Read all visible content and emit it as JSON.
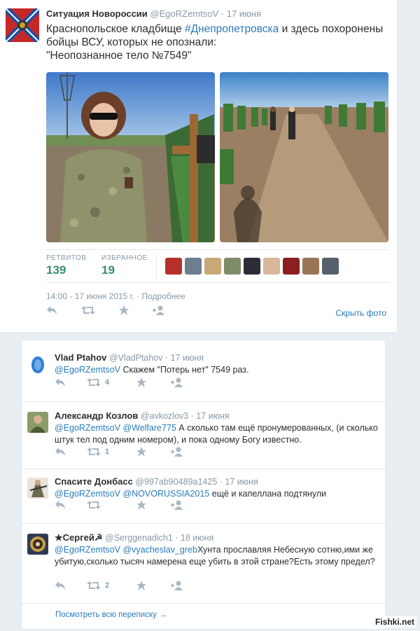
{
  "main_tweet": {
    "fullname": "Ситуация Новороссии",
    "username": "@EgoRZemtsoV",
    "date": "· 17 июня",
    "text_part1": "Краснопольское кладбище ",
    "hashtag": "#Днепропетровска",
    "text_part2": " и здесь похоронены бойцы ВСУ, которых не опознали:",
    "text_part3": "\"Неопознанное тело №7549\"",
    "retweets_label": "РЕТВИТОВ",
    "retweets": "139",
    "favorites_label": "ИЗБРАННОЕ",
    "favorites": "19",
    "timestamp": "14:00 - 17 июня 2015 г. · Подробнее",
    "hide_photo": "Скрыть фото"
  },
  "replies": [
    {
      "fullname": "Vlad Ptahov",
      "username": "@VladPtahov",
      "date": "· 17 июня",
      "mention": "@EgoRZemtsoV",
      "text": " Скажем \"Потерь нет\" 7549 раз.",
      "retweet_count": "4"
    },
    {
      "fullname": "Александр Козлов",
      "username": "@avkozlov3",
      "date": "· 17 июня",
      "mention": "@EgoRZemtsoV @Welfare775",
      "text": " А сколько там ещё пронумерованных, (и сколько штук тел под одним номером), и пока одному Богу известно.",
      "retweet_count": "1"
    },
    {
      "fullname": "Спасите Донбасс",
      "username": "@997ab90489a1425",
      "date": "· 17 июня",
      "mention": "@EgoRZemtsoV @NOVORUSSIA2015",
      "text": " ещё и капеллана подтянули",
      "retweet_count": ""
    },
    {
      "fullname": "★Сергей☭",
      "username": "@Serggenadich1",
      "date": "· 18 июня",
      "mention": "@EgoRZemtsoV @vyacheslav_greb",
      "text": "Хунта прославляя Небесную сотню,ими же убитую,сколько тысяч намерена еще убить в этой стране?Есть этому предел?",
      "retweet_count": "2"
    }
  ],
  "see_all": "Посмотреть всю переписку →",
  "watermark": "Fishki.net",
  "colors": {
    "link": "#2b7bb9",
    "stat": "#3a8d70",
    "muted": "#8899a6"
  },
  "icons": [
    "reply-icon",
    "retweet-icon",
    "favorite-icon",
    "follow-icon"
  ]
}
